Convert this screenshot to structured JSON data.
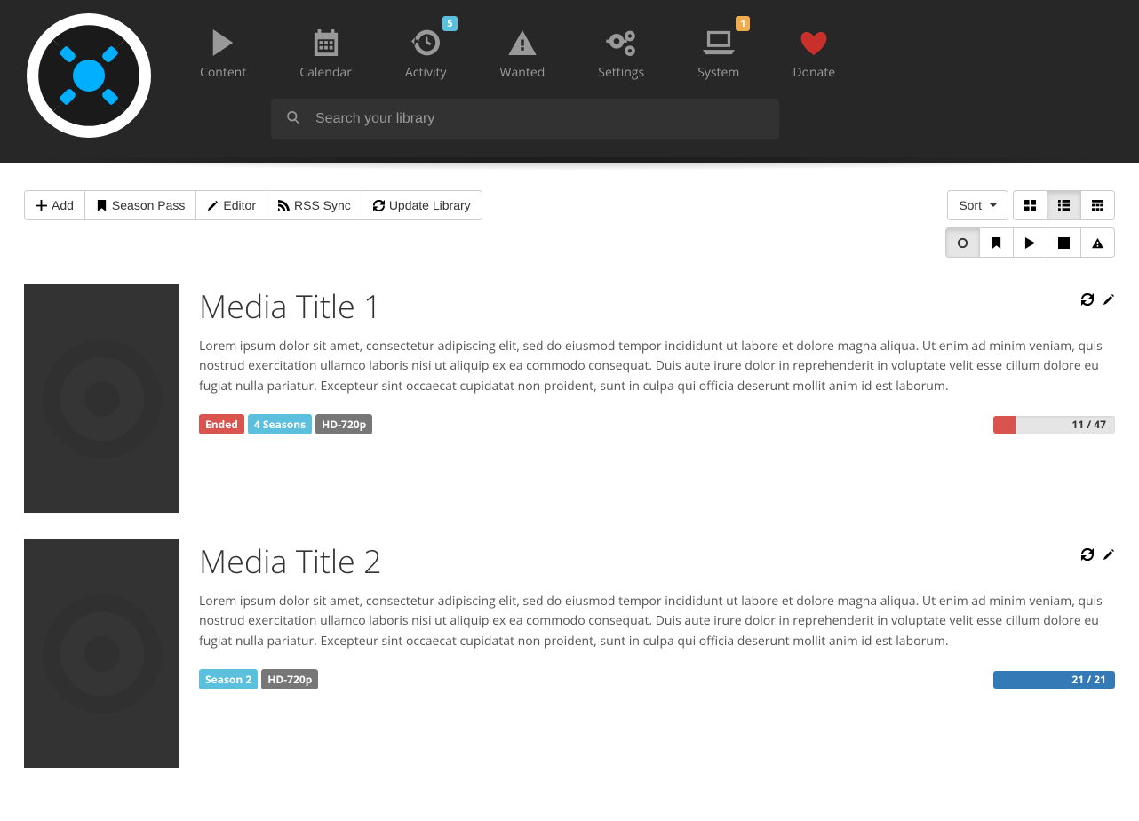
{
  "nav": {
    "items": [
      {
        "label": "Content"
      },
      {
        "label": "Calendar"
      },
      {
        "label": "Activity",
        "badge": "5",
        "badge_type": "info"
      },
      {
        "label": "Wanted"
      },
      {
        "label": "Settings"
      },
      {
        "label": "System",
        "badge": "1",
        "badge_type": "warn"
      },
      {
        "label": "Donate"
      }
    ]
  },
  "search": {
    "placeholder": "Search your library"
  },
  "toolbar": {
    "add": "Add",
    "season_pass": "Season Pass",
    "editor": "Editor",
    "rss_sync": "RSS Sync",
    "update_library": "Update Library",
    "sort": "Sort"
  },
  "media": [
    {
      "title": "Media Title 1",
      "description": "Lorem ipsum dolor sit amet, consectetur adipiscing elit, sed do eiusmod tempor incididunt ut labore et dolore magna aliqua. Ut enim ad minim veniam, quis nostrud exercitation ullamco laboris nisi ut aliquip ex ea commodo consequat. Duis aute irure dolor in reprehenderit in voluptate velit esse cillum dolore eu fugiat nulla pariatur. Excepteur sint occaecat cupidatat non proident, sunt in culpa qui officia deserunt mollit anim id est laborum.",
      "labels": [
        {
          "text": "Ended",
          "class": "label-danger"
        },
        {
          "text": "4 Seasons",
          "class": "label-info"
        },
        {
          "text": "HD-720p",
          "class": "label-default"
        }
      ],
      "progress": {
        "text": "11 / 47",
        "percent": 18,
        "class": "danger",
        "text_class": ""
      }
    },
    {
      "title": "Media Title 2",
      "description": "Lorem ipsum dolor sit amet, consectetur adipiscing elit, sed do eiusmod tempor incididunt ut labore et dolore magna aliqua. Ut enim ad minim veniam, quis nostrud exercitation ullamco laboris nisi ut aliquip ex ea commodo consequat. Duis aute irure dolor in reprehenderit in voluptate velit esse cillum dolore eu fugiat nulla pariatur. Excepteur sint occaecat cupidatat non proident, sunt in culpa qui officia deserunt mollit anim id est laborum.",
      "labels": [
        {
          "text": "Season 2",
          "class": "label-info"
        },
        {
          "text": "HD-720p",
          "class": "label-default"
        }
      ],
      "progress": {
        "text": "21 / 21",
        "percent": 100,
        "class": "primary",
        "text_class": "white"
      }
    }
  ]
}
